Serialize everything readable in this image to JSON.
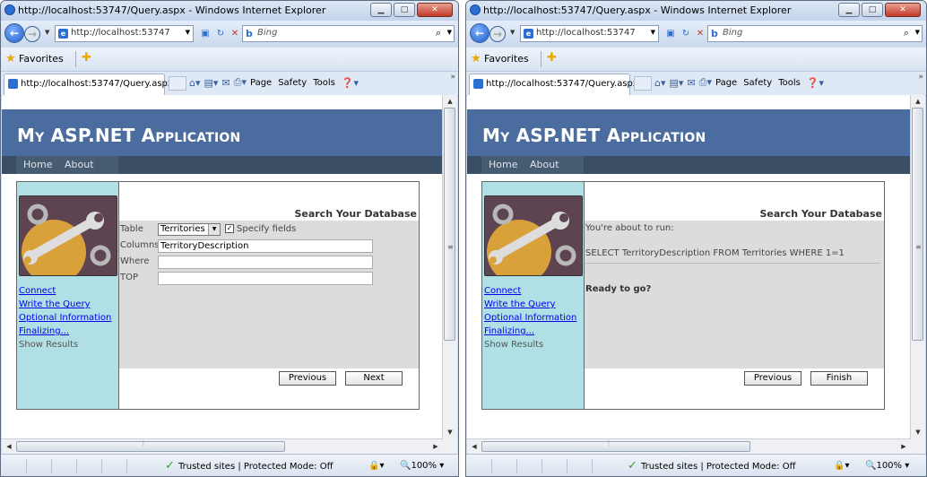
{
  "browser": {
    "window_title": "http://localhost:53747/Query.aspx - Windows Internet Explorer",
    "address": "http://localhost:53747",
    "search_placeholder": "Bing",
    "favorites_label": "Favorites",
    "tab_title": "http://localhost:53747/Query.aspx",
    "commands": [
      "Page",
      "Safety",
      "Tools"
    ],
    "status_text": "Trusted sites | Protected Mode: Off",
    "zoom": "100%"
  },
  "site": {
    "title": "My ASP.NET Application",
    "menu": [
      "Home",
      "About"
    ]
  },
  "wizard": {
    "steps": [
      "Connect",
      "Write the Query",
      "Optional Information",
      "Finalizing...",
      "Show Results"
    ],
    "heading": "Search Your Database"
  },
  "left": {
    "table_label": "Table",
    "table_value": "Territories",
    "specify_fields": "Specify fields",
    "columns_label": "Columns",
    "columns_value": "TerritoryDescription",
    "where_label": "Where",
    "where_value": "",
    "top_label": "TOP",
    "top_value": "",
    "prev_button": "Previous",
    "next_button": "Next"
  },
  "right": {
    "about_to_run": "You're about to run:",
    "query": "SELECT TerritoryDescription FROM Territories WHERE 1=1",
    "ready": "Ready to go?",
    "prev_button": "Previous",
    "finish_button": "Finish"
  }
}
